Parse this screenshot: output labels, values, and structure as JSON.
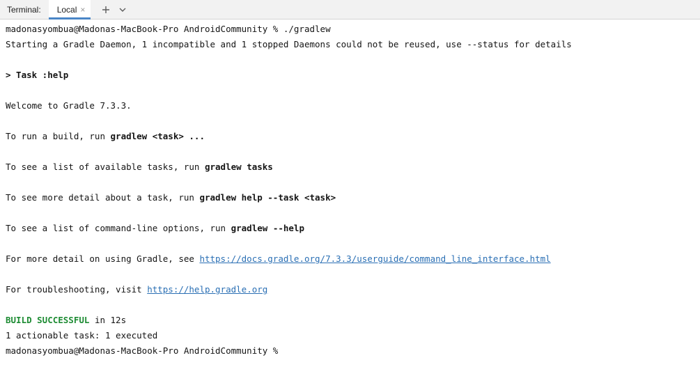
{
  "toolbar": {
    "title": "Terminal:",
    "tab_label": "Local",
    "close_icon": "×",
    "add_icon": "plus-icon",
    "menu_icon": "chevron-down-icon"
  },
  "terminal": {
    "prompt_line": "madonasyombua@Madonas-MacBook-Pro AndroidCommunity % ./gradlew",
    "daemon_line": "Starting a Gradle Daemon, 1 incompatible and 1 stopped Daemons could not be reused, use --status for details",
    "task_line": "> Task :help",
    "welcome_line": "Welcome to Gradle 7.3.3.",
    "run_build_prefix": "To run a build, run ",
    "run_build_cmd": "gradlew <task> ...",
    "tasks_prefix": "To see a list of available tasks, run ",
    "tasks_cmd": "gradlew tasks",
    "help_task_prefix": "To see more detail about a task, run ",
    "help_task_cmd": "gradlew help --task <task>",
    "options_prefix": "To see a list of command-line options, run ",
    "options_cmd": "gradlew --help",
    "detail_prefix": "For more detail on using Gradle, see ",
    "detail_link": "https://docs.gradle.org/7.3.3/userguide/command_line_interface.html",
    "trouble_prefix": "For troubleshooting, visit ",
    "trouble_link": "https://help.gradle.org",
    "build_status": "BUILD SUCCESSFUL",
    "build_time": " in 12s",
    "actionable_line": "1 actionable task: 1 executed",
    "final_prompt": "madonasyombua@Madonas-MacBook-Pro AndroidCommunity %"
  },
  "colors": {
    "link": "#2a6fb4",
    "success": "#1e8c34",
    "tab_underline": "#4a86c7"
  }
}
